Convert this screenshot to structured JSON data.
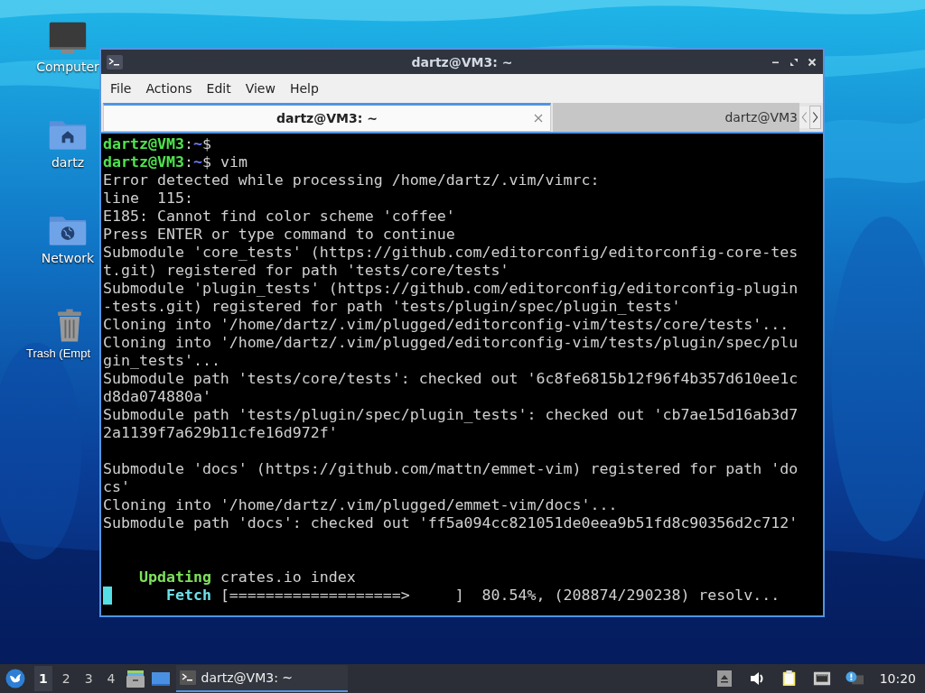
{
  "desktop": {
    "icons": [
      {
        "label": "Computer",
        "kind": "computer"
      },
      {
        "label": "dartz",
        "kind": "home"
      },
      {
        "label": "Network",
        "kind": "network"
      },
      {
        "label": "Trash (Empt",
        "kind": "trash"
      }
    ]
  },
  "window": {
    "title": "dartz@VM3: ~",
    "menu": [
      "File",
      "Actions",
      "Edit",
      "View",
      "Help"
    ],
    "tabs": [
      {
        "label": "dartz@VM3: ~",
        "selected": true
      },
      {
        "label": "dartz@VM3",
        "selected": false
      }
    ],
    "terminal": {
      "lines": [
        {
          "segments": [
            {
              "text": "dartz@VM3",
              "kind": "user"
            },
            {
              "text": ":",
              "kind": "plain"
            },
            {
              "text": "~",
              "kind": "path"
            },
            {
              "text": "$",
              "kind": "plain"
            }
          ]
        },
        {
          "segments": [
            {
              "text": "dartz@VM3",
              "kind": "user"
            },
            {
              "text": ":",
              "kind": "plain"
            },
            {
              "text": "~",
              "kind": "path"
            },
            {
              "text": "$ vim",
              "kind": "plain"
            }
          ]
        },
        {
          "segments": [
            {
              "text": "Error detected while processing /home/dartz/.vim/vimrc:",
              "kind": "plain"
            }
          ]
        },
        {
          "segments": [
            {
              "text": "line  115:",
              "kind": "plain"
            }
          ]
        },
        {
          "segments": [
            {
              "text": "E185: Cannot find color scheme 'coffee'",
              "kind": "plain"
            }
          ]
        },
        {
          "segments": [
            {
              "text": "Press ENTER or type command to continue",
              "kind": "plain"
            }
          ]
        },
        {
          "segments": [
            {
              "text": "Submodule 'core_tests' (https://github.com/editorconfig/editorconfig-core-tes",
              "kind": "plain"
            }
          ]
        },
        {
          "segments": [
            {
              "text": "t.git) registered for path 'tests/core/tests'",
              "kind": "plain"
            }
          ]
        },
        {
          "segments": [
            {
              "text": "Submodule 'plugin_tests' (https://github.com/editorconfig/editorconfig-plugin",
              "kind": "plain"
            }
          ]
        },
        {
          "segments": [
            {
              "text": "-tests.git) registered for path 'tests/plugin/spec/plugin_tests'",
              "kind": "plain"
            }
          ]
        },
        {
          "segments": [
            {
              "text": "Cloning into '/home/dartz/.vim/plugged/editorconfig-vim/tests/core/tests'...",
              "kind": "plain"
            }
          ]
        },
        {
          "segments": [
            {
              "text": "Cloning into '/home/dartz/.vim/plugged/editorconfig-vim/tests/plugin/spec/plu",
              "kind": "plain"
            }
          ]
        },
        {
          "segments": [
            {
              "text": "gin_tests'...",
              "kind": "plain"
            }
          ]
        },
        {
          "segments": [
            {
              "text": "Submodule path 'tests/core/tests': checked out '6c8fe6815b12f96f4b357d610ee1c",
              "kind": "plain"
            }
          ]
        },
        {
          "segments": [
            {
              "text": "d8da074880a'",
              "kind": "plain"
            }
          ]
        },
        {
          "segments": [
            {
              "text": "Submodule path 'tests/plugin/spec/plugin_tests': checked out 'cb7ae15d16ab3d7",
              "kind": "plain"
            }
          ]
        },
        {
          "segments": [
            {
              "text": "2a1139f7a629b11cfe16d972f'",
              "kind": "plain"
            }
          ]
        },
        {
          "kind": "blank"
        },
        {
          "segments": [
            {
              "text": "Submodule 'docs' (https://github.com/mattn/emmet-vim) registered for path 'do",
              "kind": "plain"
            }
          ]
        },
        {
          "segments": [
            {
              "text": "cs'",
              "kind": "plain"
            }
          ]
        },
        {
          "segments": [
            {
              "text": "Cloning into '/home/dartz/.vim/plugged/emmet-vim/docs'...",
              "kind": "plain"
            }
          ]
        },
        {
          "segments": [
            {
              "text": "Submodule path 'docs': checked out 'ff5a094cc821051de0eea9b51fd8c90356d2c712'",
              "kind": "plain"
            }
          ]
        },
        {
          "kind": "blank"
        },
        {
          "kind": "blank"
        },
        {
          "segments": [
            {
              "text": "Updating",
              "kind": "status-ok"
            },
            {
              "text": " crates.io index",
              "kind": "plain"
            }
          ]
        },
        {
          "cursor": true,
          "segments": [
            {
              "text": "Fetch",
              "kind": "status-info"
            },
            {
              "text": " [===================>     ]  80.54%, (208874/290238) resolv...",
              "kind": "plain"
            }
          ]
        }
      ]
    }
  },
  "taskbar": {
    "workspaces": [
      {
        "label": "1",
        "selected": true
      },
      {
        "label": "2",
        "selected": false
      },
      {
        "label": "3",
        "selected": false
      },
      {
        "label": "4",
        "selected": false
      }
    ],
    "tasks": [
      {
        "label": "dartz@VM3: ~",
        "selected": true
      }
    ],
    "clock": "10:20"
  }
}
